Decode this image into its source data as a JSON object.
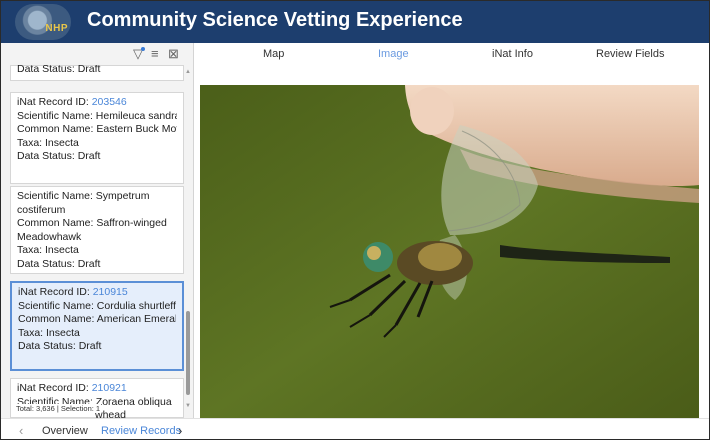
{
  "header": {
    "logo_text": "NHP",
    "title": "Community Science Vetting Experience"
  },
  "toolbar": {
    "filter_icon": "filter-icon",
    "list_icon": "list-icon",
    "clear_selection_icon": "clear-selection-icon"
  },
  "records": [
    {
      "status_line": "Data Status: Draft"
    },
    {
      "id_label": "iNat Record ID: ",
      "id": "203546",
      "scientific": "Scientific Name: Hemileuca sandra",
      "common": "Common Name: Eastern Buck Moth",
      "taxa": "Taxa: Insecta",
      "status": "Data Status: Draft"
    },
    {
      "scientific_1": "Scientific Name: Sympetrum",
      "scientific_2": "costiferum",
      "common_1": "Common Name: Saffron-winged",
      "common_2": "Meadowhawk",
      "taxa": "Taxa: Insecta",
      "status": "Data Status: Draft"
    },
    {
      "id_label": "iNat Record ID: ",
      "id": "210915",
      "scientific": "Scientific Name: Cordulia shurtleffii",
      "common": "Common Name: American Emerald",
      "taxa": "Taxa: Insecta",
      "status": "Data Status: Draft"
    },
    {
      "id_label": "iNat Record ID: ",
      "id": "210921",
      "scientific": "Scientific Name: Zoraena obliqua",
      "common_partial": "whead"
    }
  ],
  "total_text": "Total: 3,636 | Selection: 1",
  "tabs": {
    "map": "Map",
    "image": "Image",
    "inat_info": "iNat Info",
    "review_fields": "Review Fields",
    "active": "image"
  },
  "bottom_nav": {
    "overview": "Overview",
    "review_records": "Review Records"
  },
  "colors": {
    "header": "#1d3e6e",
    "accent": "#4a86d8",
    "selected_card": "#e5eefb",
    "image_background": "#556b1e"
  }
}
